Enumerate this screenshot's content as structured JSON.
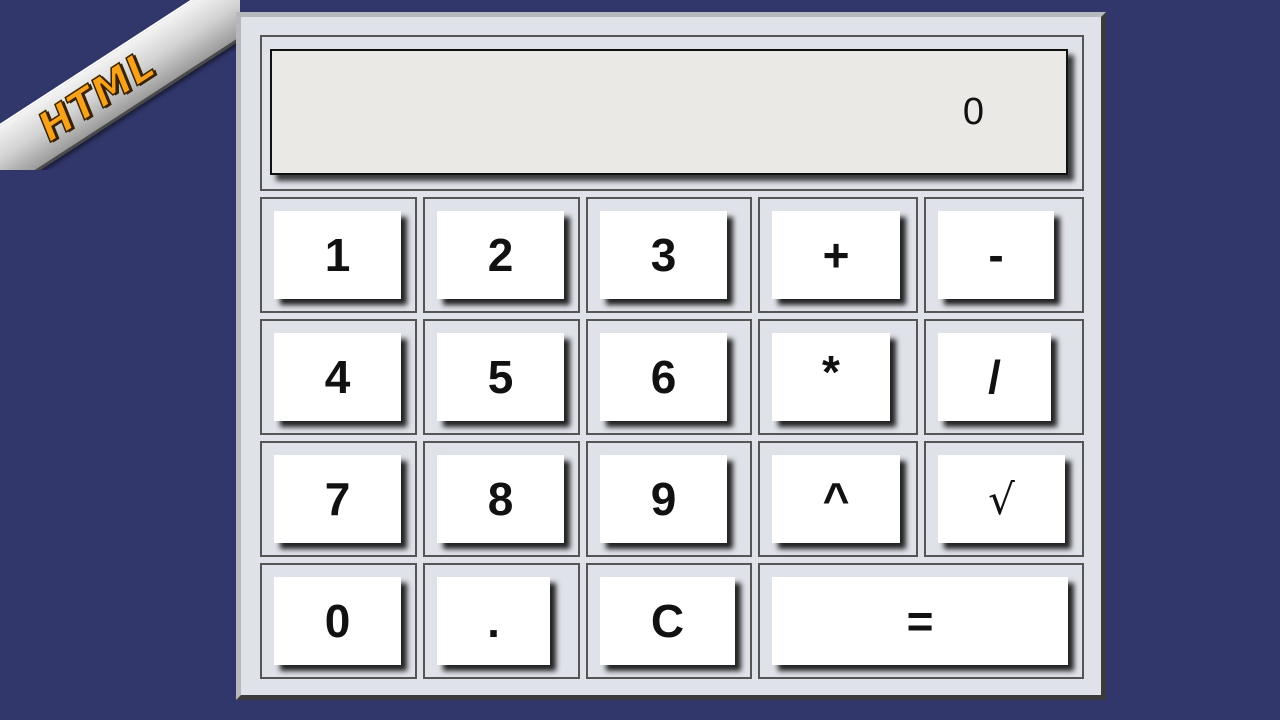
{
  "badge": {
    "text": "HTML"
  },
  "calculator": {
    "display_value": "0",
    "rows": [
      [
        {
          "label": "1",
          "name": "key-1"
        },
        {
          "label": "2",
          "name": "key-2"
        },
        {
          "label": "3",
          "name": "key-3"
        },
        {
          "label": "+",
          "name": "key-add"
        },
        {
          "label": "-",
          "name": "key-subtract"
        }
      ],
      [
        {
          "label": "4",
          "name": "key-4"
        },
        {
          "label": "5",
          "name": "key-5"
        },
        {
          "label": "6",
          "name": "key-6"
        },
        {
          "label": "*",
          "name": "key-multiply"
        },
        {
          "label": "/",
          "name": "key-divide"
        }
      ],
      [
        {
          "label": "7",
          "name": "key-7"
        },
        {
          "label": "8",
          "name": "key-8"
        },
        {
          "label": "9",
          "name": "key-9"
        },
        {
          "label": "^",
          "name": "key-power"
        },
        {
          "label": "√",
          "name": "key-sqrt"
        }
      ],
      [
        {
          "label": "0",
          "name": "key-0"
        },
        {
          "label": ".",
          "name": "key-decimal"
        },
        {
          "label": "C",
          "name": "key-clear"
        },
        {
          "label": "=",
          "name": "key-equals"
        }
      ]
    ]
  },
  "colors": {
    "background": "#31376b",
    "panel": "#dfe2e8",
    "display": "#ebe9e5",
    "button": "#ffffff",
    "badge_text": "#f7a21a"
  }
}
